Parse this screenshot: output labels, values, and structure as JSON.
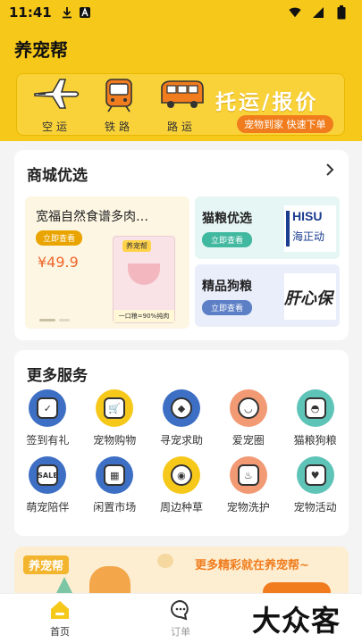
{
  "status_bar": {
    "time": "11:41"
  },
  "app": {
    "title": "养宠帮"
  },
  "banner": {
    "modes": [
      {
        "label": "空运",
        "icon": "airplane-icon"
      },
      {
        "label": "铁路",
        "icon": "train-icon"
      },
      {
        "label": "路运",
        "icon": "bus-icon"
      }
    ],
    "headline": "托运/报价",
    "subline": "宠物到家 快速下单"
  },
  "mall": {
    "title": "商城优选",
    "main_product": {
      "name": "宽福自然食谱多肉…",
      "button": "立即查看",
      "price": "¥49.9",
      "bag_brand": "养宠帮",
      "bag_tagline": "一口粮=90%纯肉"
    },
    "side_products": [
      {
        "name": "猫粮优选",
        "button": "立即查看",
        "thumb_text": "HISU",
        "thumb_sub": "海正动"
      },
      {
        "name": "精品狗粮",
        "button": "立即查看",
        "thumb_text": "肝心保"
      }
    ]
  },
  "services": {
    "title": "更多服务",
    "items": [
      {
        "label": "签到有礼",
        "icon": "calendar-check-icon",
        "color": "#3d6fc4"
      },
      {
        "label": "宠物购物",
        "icon": "shopping-cart-icon",
        "color": "#f6c81a"
      },
      {
        "label": "寻宠求助",
        "icon": "bird-icon",
        "color": "#3d6fc4"
      },
      {
        "label": "爱宠圈",
        "icon": "pet-face-icon",
        "color": "#f29a74"
      },
      {
        "label": "猫粮狗粮",
        "icon": "food-bowl-icon",
        "color": "#5fc4b8"
      },
      {
        "label": "萌宠陪伴",
        "icon": "sale-tag-icon",
        "color": "#3d6fc4"
      },
      {
        "label": "闲置市场",
        "icon": "building-icon",
        "color": "#3d6fc4"
      },
      {
        "label": "周边种草",
        "icon": "camera-icon",
        "color": "#f6c81a"
      },
      {
        "label": "宠物洗护",
        "icon": "bath-icon",
        "color": "#f29a74"
      },
      {
        "label": "宠物活动",
        "icon": "heart-chat-icon",
        "color": "#5fc4b8"
      }
    ]
  },
  "promo": {
    "brand": "养宠帮",
    "text": "更多精彩就在养宠帮~"
  },
  "tabbar": {
    "tabs": [
      {
        "label": "首页",
        "icon": "home-icon"
      },
      {
        "label": "订单",
        "icon": "chat-icon"
      }
    ]
  },
  "watermark": "大众客"
}
